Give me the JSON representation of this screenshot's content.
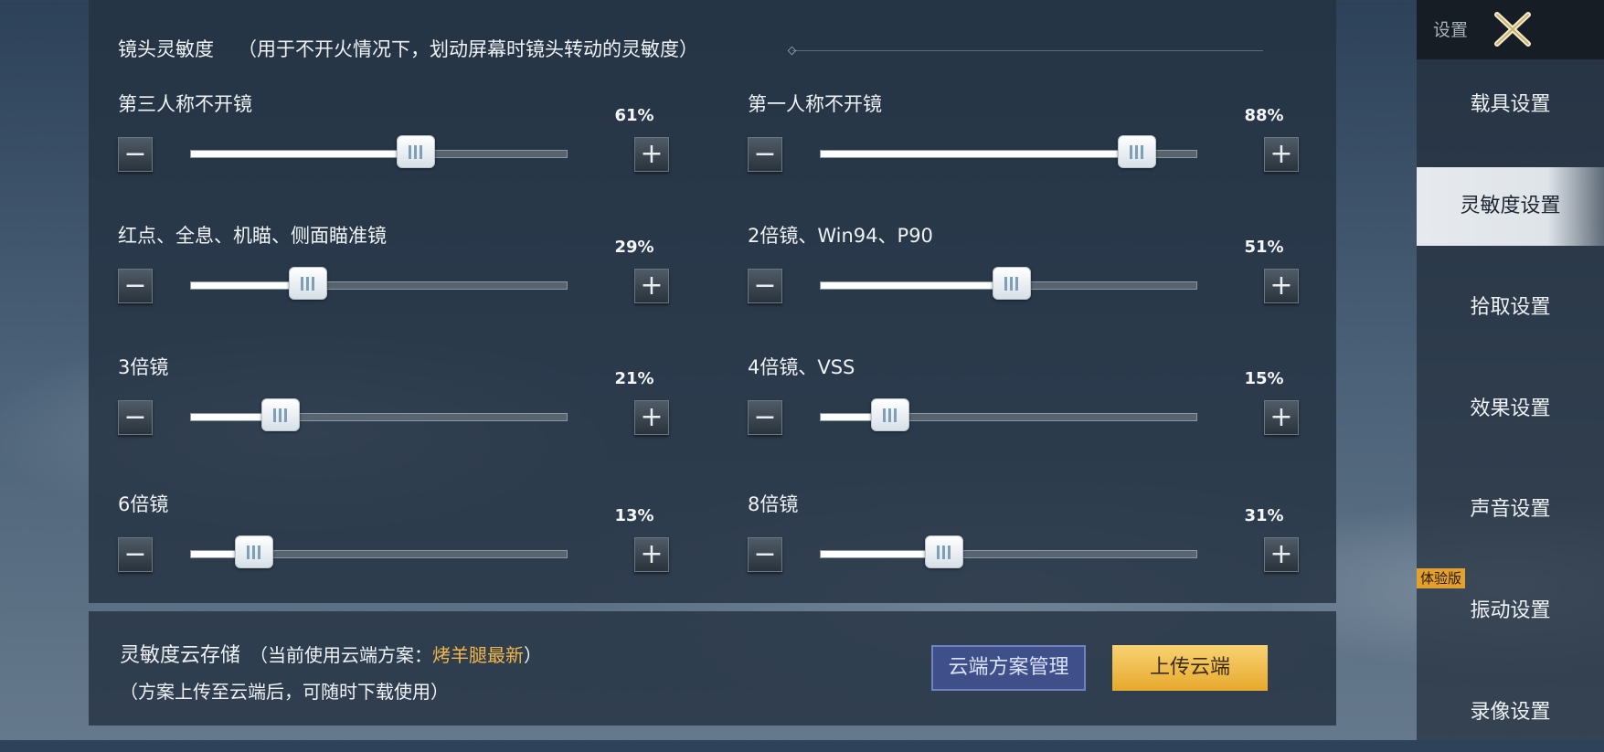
{
  "section": {
    "title": "镜头灵敏度",
    "note": "（用于不开火情况下，划动屏幕时镜头转动的灵敏度）"
  },
  "sliders": [
    {
      "label": "第三人称不开镜",
      "percent_text": "61%",
      "value": 0.61
    },
    {
      "label": "第一人称不开镜",
      "percent_text": "88%",
      "value": 0.88
    },
    {
      "label": "红点、全息、机瞄、侧面瞄准镜",
      "percent_text": "29%",
      "value": 0.29
    },
    {
      "label": "2倍镜、Win94、P90",
      "percent_text": "51%",
      "value": 0.51
    },
    {
      "label": "3倍镜",
      "percent_text": "21%",
      "value": 0.21
    },
    {
      "label": "4倍镜、VSS",
      "percent_text": "15%",
      "value": 0.15
    },
    {
      "label": "6倍镜",
      "percent_text": "13%",
      "value": 0.13
    },
    {
      "label": "8倍镜",
      "percent_text": "31%",
      "value": 0.31
    }
  ],
  "buttons": {
    "minus": "−",
    "plus": "+"
  },
  "cloud": {
    "title": "灵敏度云存储",
    "current_prefix": "（当前使用云端方案：",
    "current_scheme": "烤羊腿最新",
    "current_suffix": "）",
    "description": "（方案上传至云端后，可随时下载使用）",
    "manage_button": "云端方案管理",
    "upload_button": "上传云端"
  },
  "sidebar": {
    "title": "设置",
    "close_icon": "close-x-icon",
    "items": [
      {
        "label": "载具设置",
        "active": false
      },
      {
        "label": "灵敏度设置",
        "active": true
      },
      {
        "label": "拾取设置",
        "active": false
      },
      {
        "label": "效果设置",
        "active": false
      },
      {
        "label": "声音设置",
        "active": false
      },
      {
        "label": "振动设置",
        "active": false
      },
      {
        "label": "录像设置",
        "active": false
      }
    ],
    "trial_badge": "体验版"
  },
  "colors": {
    "accent_gold": "#f2b64a",
    "upload_button": "#e7a92d",
    "manage_button": "#3e4f8a"
  }
}
